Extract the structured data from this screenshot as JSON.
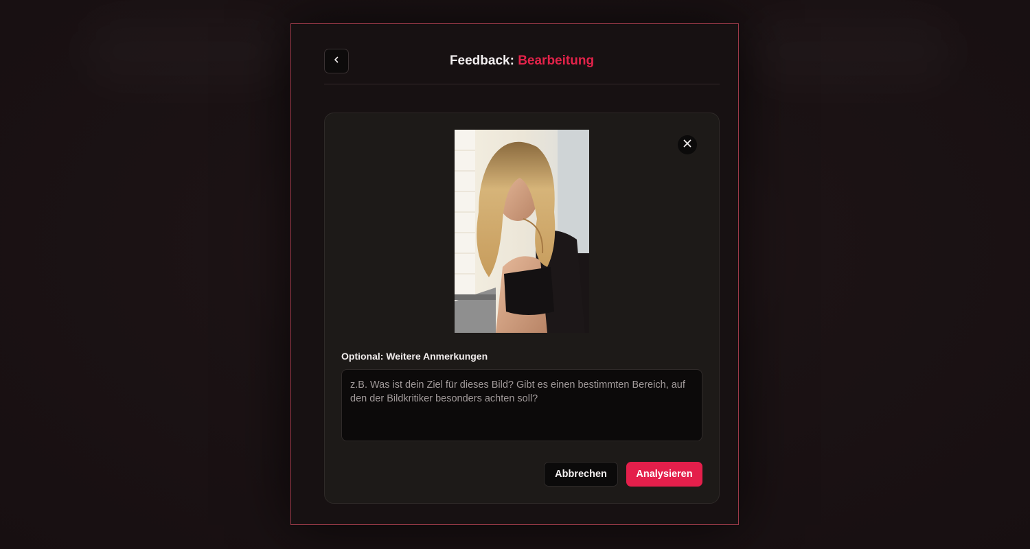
{
  "header": {
    "title_prefix": "Feedback:",
    "title_accent": "Bearbeitung",
    "back_icon": "chevron-left-icon"
  },
  "upload": {
    "close_icon": "close-icon",
    "image_alt": "Hochgeladenes Bild"
  },
  "notes": {
    "label": "Optional: Weitere Anmerkungen",
    "value": "",
    "placeholder": "z.B. Was ist dein Ziel für dieses Bild? Gibt es einen bestimmten Bereich, auf den der Bildkritiker besonders achten soll?"
  },
  "actions": {
    "cancel_label": "Abbrechen",
    "analyze_label": "Analysieren"
  },
  "colors": {
    "accent": "#e3234a",
    "dialog_border": "#9c3a49",
    "background": "#171112"
  }
}
